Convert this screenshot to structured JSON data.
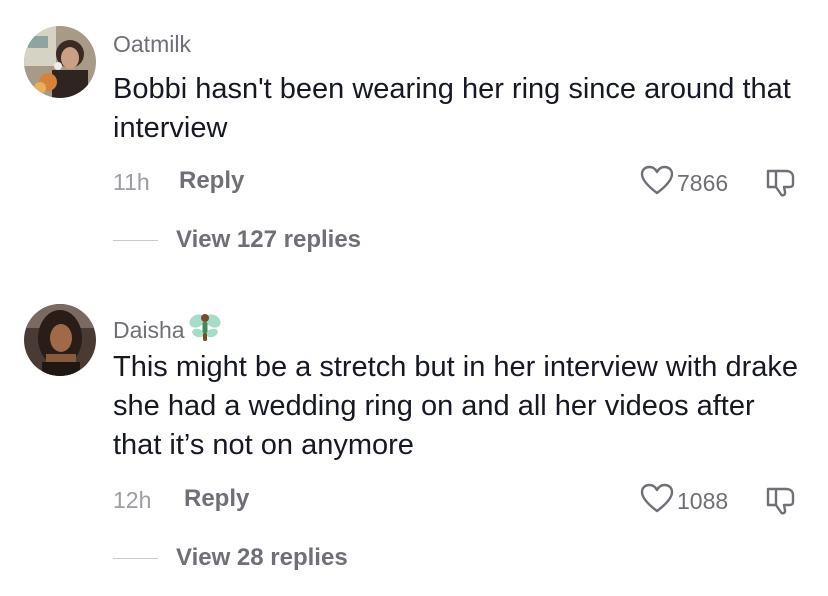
{
  "comments": [
    {
      "username": "Oatmilk",
      "username_emoji": "",
      "text": "Bobbi hasn't been wearing her ring since around that interview",
      "time": "11h",
      "reply_label": "Reply",
      "likes": "7866",
      "view_replies": "View 127 replies"
    },
    {
      "username": "Daisha",
      "username_emoji": "fairy",
      "text": "This might be a stretch but in her interview with drake she had a wedding ring on and all her videos after that it’s not on anymore",
      "time": "12h",
      "reply_label": "Reply",
      "likes": "1088",
      "view_replies": "View 28 replies"
    }
  ],
  "icons": {
    "like": "heart-outline-icon",
    "dislike": "thumbs-down-outline-icon"
  },
  "colors": {
    "text": "#161823",
    "secondary": "#6f6f77",
    "timestamp": "#9c9ca3"
  }
}
